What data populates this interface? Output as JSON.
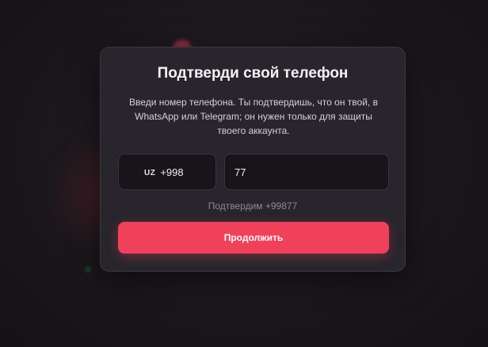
{
  "modal": {
    "title": "Подтверди свой телефон",
    "description": "Введи номер телефона. Ты подтвердишь, что он твой, в WhatsApp или Telegram; он нужен только для защиты твоего аккаунта.",
    "country": {
      "flag_label": "UZ",
      "dial_code": "+998"
    },
    "phone_value": "77",
    "confirm_hint": "Подтвердим +99877",
    "continue_label": "Продолжить"
  },
  "colors": {
    "accent": "#f0405a",
    "modal_bg": "#28252c",
    "input_bg": "#17151a",
    "page_bg": "#17151a"
  }
}
